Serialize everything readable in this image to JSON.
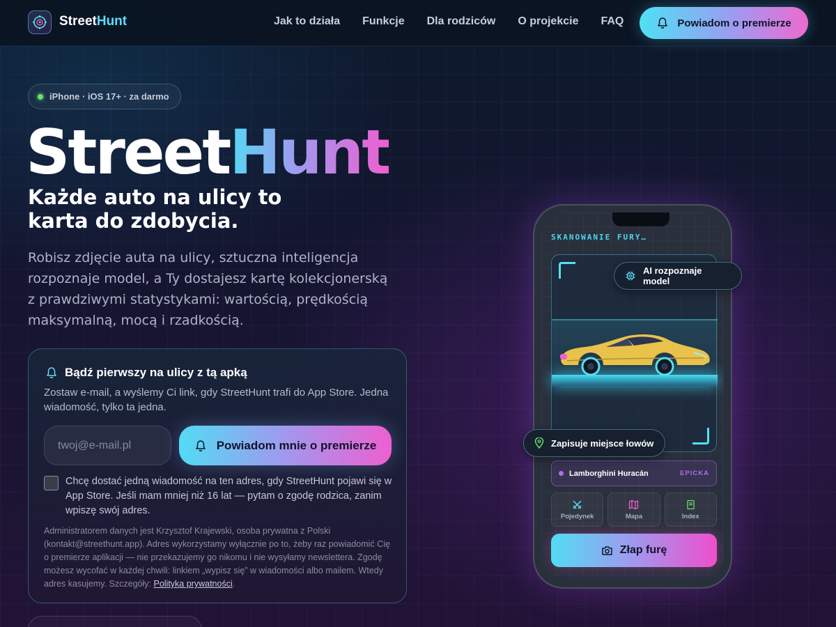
{
  "brand": {
    "name_white": "Street",
    "name_accent": "Hunt"
  },
  "nav": {
    "links": [
      "Jak to działa",
      "Funkcje",
      "Dla rodziców",
      "O projekcie",
      "FAQ"
    ],
    "cta": "Powiadom o premierze"
  },
  "hero": {
    "badge": "iPhone · iOS 17+ · za darmo",
    "title_white": "Street",
    "title_accent": "Hunt",
    "subtitle_line1": "Każde auto na ulicy to",
    "subtitle_line2": "karta do zdobycia.",
    "description": "Robisz zdjęcie auta na ulicy, sztuczna inteligencja rozpoznaje model, a Ty dostajesz kartę kolekcjonerską z prawdziwymi statystykami: wartością, prędkością maksymalną, mocą i rzadkością."
  },
  "signup": {
    "heading": "Bądź pierwszy na ulicy z tą apką",
    "text": "Zostaw e-mail, a wyślemy Ci link, gdy StreetHunt trafi do App Store. Jedna wiadomość, tylko ta jedna.",
    "email_placeholder": "twoj@e-mail.pl",
    "email_value": "",
    "submit": "Powiadom mnie o premierze",
    "consent": "Chcę dostać jedną wiadomość na ten adres, gdy StreetHunt pojawi się w App Store. Jeśli mam mniej niż 16 lat — pytam o zgodę rodzica, zanim wpiszę swój adres.",
    "consent_checked": false,
    "legal": "Administratorem danych jest Krzysztof Krajewski, osoba prywatna z Polski (kontakt@streethunt.app). Adres wykorzystamy wyłącznie po to, żeby raz powiadomić Cię o premierze aplikacji — nie przekazujemy go nikomu i nie wysyłamy newslettera. Zgodę możesz wycofać w każdej chwili: linkiem „wypisz się” w wiadomości albo mailem. Wtedy adres kasujemy. Szczegóły: ",
    "legal_link": "Polityka prywatności",
    "legal_end": "."
  },
  "phone": {
    "scan_label": "SKANOWANIE FURY…",
    "chip_ai": "AI rozpoznaje model",
    "chip_location": "Zapisuje miejsce łowów",
    "result_name": "Lamborghini Huracán",
    "result_tier": "EPICKA",
    "tiles": [
      "Pojedynek",
      "Mapa",
      "Index"
    ],
    "catch_button": "Złap furę"
  },
  "colors": {
    "accent_cyan": "#52dcf4",
    "accent_purple": "#a198ee",
    "accent_pink": "#ee5fd0",
    "tier_epic": "#b56cf0",
    "status_green": "#6be06b"
  },
  "icons": [
    "crosshair-bolt-logo-icon",
    "bell-icon",
    "chip-icon",
    "location-pin-icon",
    "swords-icon",
    "map-icon",
    "book-icon",
    "camera-icon",
    "sports-car-illustration"
  ]
}
